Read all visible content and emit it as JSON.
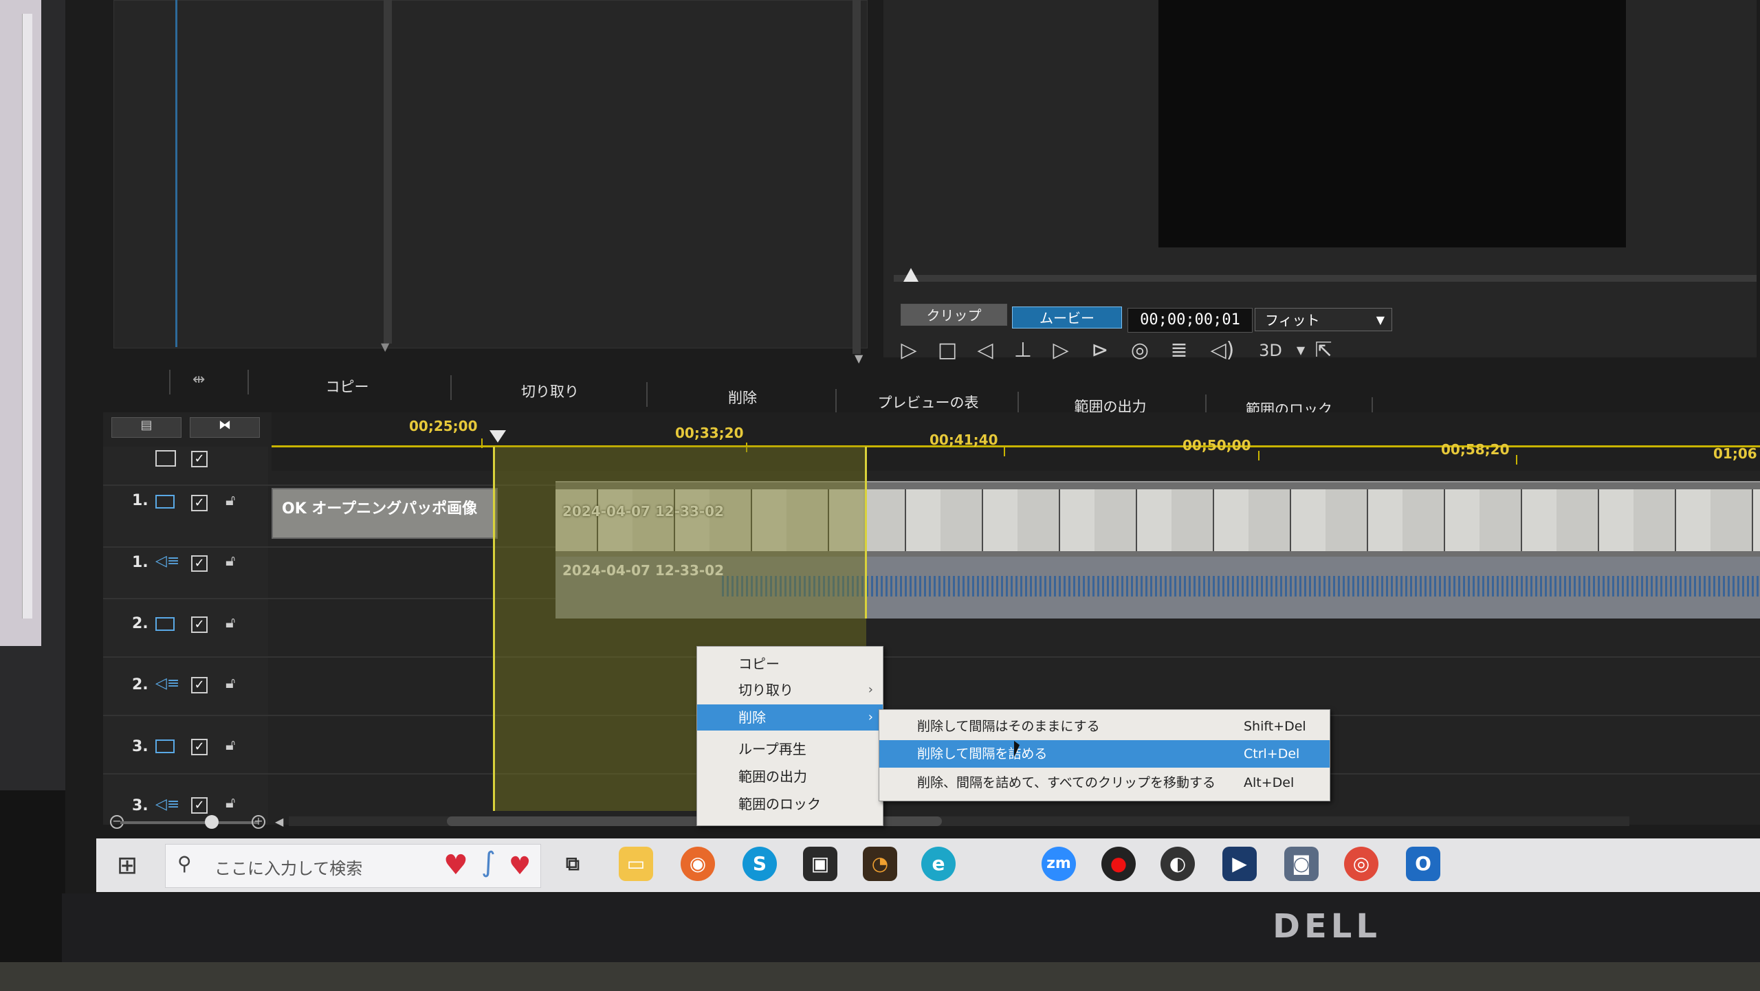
{
  "toolbar": {
    "copy": "コピー",
    "cut": "切り取り",
    "delete": "削除",
    "show_preview": "プレビューの表示",
    "output_range": "範囲の出力",
    "lock_range": "範囲のロック"
  },
  "preview": {
    "tab_clip": "クリップ",
    "tab_movie": "ムービー",
    "timecode": "00;00;00;01",
    "zoom": "フィット",
    "mode_3d": "3D"
  },
  "ruler": {
    "labels": [
      "00;25;00",
      "00;33;20",
      "00;41;40",
      "00;50;00",
      "00;58;20",
      "01;06"
    ]
  },
  "tracks": [
    {
      "num": "1.",
      "kind": "video"
    },
    {
      "num": "1.",
      "kind": "audio"
    },
    {
      "num": "2.",
      "kind": "video"
    },
    {
      "num": "2.",
      "kind": "audio"
    },
    {
      "num": "3.",
      "kind": "video"
    },
    {
      "num": "3.",
      "kind": "audio"
    }
  ],
  "clips": {
    "title_clip": "OK オープニングパッポ画像",
    "video_clip": "2024-04-07 12-33-02",
    "audio_clip": "2024-04-07 12-33-02"
  },
  "context_menu": {
    "items": [
      "コピー",
      "切り取り",
      "削除",
      "ループ再生",
      "範囲の出力",
      "範囲のロック"
    ],
    "submenu_arrow": "›"
  },
  "submenu": {
    "items": [
      {
        "label": "削除して間隔はそのままにする",
        "shortcut": "Shift+Del"
      },
      {
        "label": "削除して間隔を詰める",
        "shortcut": "Ctrl+Del"
      },
      {
        "label": "削除、間隔を詰めて、すべてのクリップを移動する",
        "shortcut": "Alt+Del"
      }
    ]
  },
  "taskbar": {
    "search_placeholder": "ここに入力して検索"
  },
  "monitor_brand": "DELL",
  "colors": {
    "selection_accent": "#3a8fd6",
    "ruler_yellow": "#e7c93a",
    "movie_tab": "#1e6fa8"
  }
}
